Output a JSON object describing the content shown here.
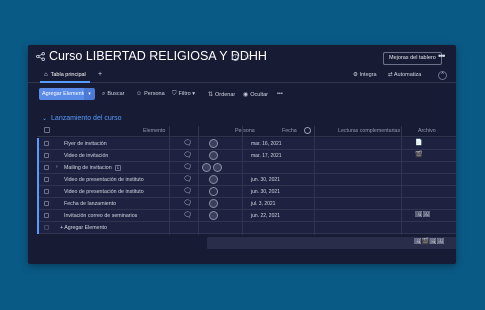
{
  "header": {
    "board_title": "Curso LIBERTAD RELIGIOSA Y DDHH",
    "improve_button": "Mejoras del tablero",
    "more_label": "•••"
  },
  "tabs": {
    "main_tab": "Tabla principal",
    "add_tab": "+",
    "integrate": "Integra",
    "automate": "Automatiza",
    "collapse": "^"
  },
  "toolbar": {
    "add_item": "Agregar Elemento",
    "dropdown_arrow": "▾",
    "search": "Buscar",
    "person": "Persona",
    "filter": "Filtro",
    "sort": "Ordenar",
    "hide": "Ocultar",
    "more": "•••"
  },
  "group": {
    "title": "Lanzamiento del curso",
    "color": "#579bfc"
  },
  "columns": {
    "item": "Elemento",
    "person": "Persona",
    "date": "Fecha",
    "readings": "Lecturas complementarias",
    "file": "Archivo"
  },
  "rows": [
    {
      "name": "Flyer de invitación",
      "date": "mar. 16, 2021",
      "file": "📄"
    },
    {
      "name": "Video de invitación",
      "date": "mar. 17, 2021",
      "file": "🎬"
    },
    {
      "name": "Mailing de invitacion",
      "count": "1",
      "date": "",
      "file": ""
    },
    {
      "name": "Video de presentación de instituto",
      "date": "jun. 30, 2021",
      "file": ""
    },
    {
      "name": "Video de presentación de instituto",
      "date": "jun. 30, 2021",
      "file": ""
    },
    {
      "name": "Fecha de lanzamiento",
      "date": "jul. 3, 2021",
      "file": ""
    },
    {
      "name": "Invitación correo de seminarios",
      "date": "jun. 22, 2021",
      "file": "🖼🖼"
    }
  ],
  "add_item_row": "+ Agregar Elemento",
  "summary_files": "🖼🎬🖼🖼"
}
